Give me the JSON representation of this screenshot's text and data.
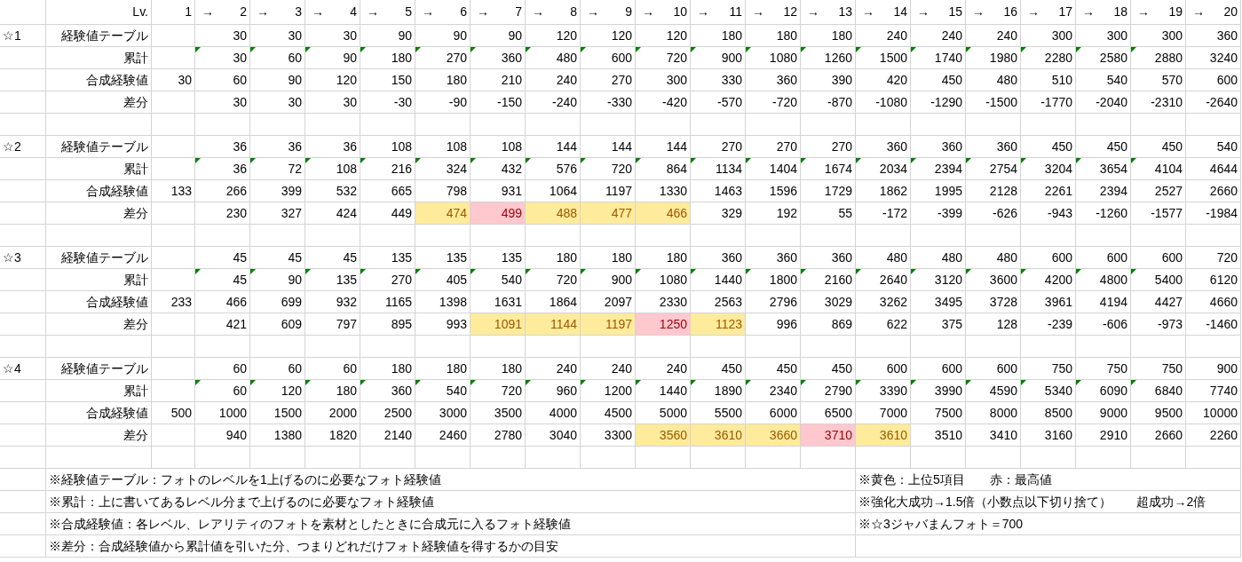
{
  "header": {
    "label": "Lv.",
    "levels": [
      {
        "num": "1"
      },
      {
        "arrow": "→",
        "num": "2"
      },
      {
        "arrow": "→",
        "num": "3"
      },
      {
        "arrow": "→",
        "num": "4"
      },
      {
        "arrow": "→",
        "num": "5"
      },
      {
        "arrow": "→",
        "num": "6"
      },
      {
        "arrow": "→",
        "num": "7"
      },
      {
        "arrow": "→",
        "num": "8"
      },
      {
        "arrow": "→",
        "num": "9"
      },
      {
        "arrow": "→",
        "num": "10"
      },
      {
        "arrow": "→",
        "num": "11"
      },
      {
        "arrow": "→",
        "num": "12"
      },
      {
        "arrow": "→",
        "num": "13"
      },
      {
        "arrow": "→",
        "num": "14"
      },
      {
        "arrow": "→",
        "num": "15"
      },
      {
        "arrow": "→",
        "num": "16"
      },
      {
        "arrow": "→",
        "num": "17"
      },
      {
        "arrow": "→",
        "num": "18"
      },
      {
        "arrow": "→",
        "num": "19"
      },
      {
        "arrow": "→",
        "num": "20"
      }
    ]
  },
  "groups": [
    {
      "rarity": "☆1",
      "rows": [
        {
          "kind": "table",
          "label": "経験値テーブル",
          "cells": [
            "",
            "30",
            "30",
            "30",
            "90",
            "90",
            "90",
            "120",
            "120",
            "120",
            "180",
            "180",
            "180",
            "240",
            "240",
            "240",
            "300",
            "300",
            "300",
            "360"
          ]
        },
        {
          "kind": "cumulative",
          "label": "累計",
          "cells": [
            {
              "flag": false
            },
            {
              "v": "30",
              "flag": true
            },
            {
              "v": "60",
              "flag": true
            },
            {
              "v": "90",
              "flag": true
            },
            {
              "v": "180",
              "flag": true
            },
            {
              "v": "270",
              "flag": true
            },
            {
              "v": "360",
              "flag": true
            },
            {
              "v": "480",
              "flag": true
            },
            {
              "v": "600",
              "flag": true
            },
            {
              "v": "720",
              "flag": true
            },
            {
              "v": "900",
              "flag": true
            },
            {
              "v": "1080",
              "flag": true
            },
            {
              "v": "1260",
              "flag": true
            },
            {
              "v": "1500",
              "flag": true
            },
            {
              "v": "1740",
              "flag": true
            },
            {
              "v": "1980",
              "flag": true
            },
            {
              "v": "2280",
              "flag": true
            },
            {
              "v": "2580",
              "flag": true
            },
            {
              "v": "2880",
              "flag": true
            },
            {
              "v": "3240",
              "flag": false
            }
          ]
        },
        {
          "kind": "synth",
          "label": "合成経験値",
          "cells": [
            "30",
            "60",
            "90",
            "120",
            "150",
            "180",
            "210",
            "240",
            "270",
            "300",
            "330",
            "360",
            "390",
            "420",
            "450",
            "480",
            "510",
            "540",
            "570",
            "600"
          ]
        },
        {
          "kind": "diff",
          "label": "差分",
          "cells": [
            {
              "top5": false,
              "max": false
            },
            {
              "v": "30",
              "top5": false,
              "max": false
            },
            {
              "v": "30",
              "top5": false,
              "max": false
            },
            {
              "v": "30",
              "top5": false,
              "max": false
            },
            {
              "v": "-30",
              "top5": false,
              "max": false
            },
            {
              "v": "-90",
              "top5": false,
              "max": false
            },
            {
              "v": "-150",
              "top5": false,
              "max": false
            },
            {
              "v": "-240",
              "top5": false,
              "max": false
            },
            {
              "v": "-330",
              "top5": false,
              "max": false
            },
            {
              "v": "-420",
              "top5": false,
              "max": false
            },
            {
              "v": "-570",
              "top5": false,
              "max": false
            },
            {
              "v": "-720",
              "top5": false,
              "max": false
            },
            {
              "v": "-870",
              "top5": false,
              "max": false
            },
            {
              "v": "-1080",
              "top5": false,
              "max": false
            },
            {
              "v": "-1290",
              "top5": false,
              "max": false
            },
            {
              "v": "-1500",
              "top5": false,
              "max": false
            },
            {
              "v": "-1770",
              "top5": false,
              "max": false
            },
            {
              "v": "-2040",
              "top5": false,
              "max": false
            },
            {
              "v": "-2310",
              "top5": false,
              "max": false
            },
            {
              "v": "-2640",
              "top5": false,
              "max": false
            }
          ]
        }
      ]
    },
    {
      "rarity": "☆2",
      "rows": [
        {
          "kind": "table",
          "label": "経験値テーブル",
          "cells": [
            "",
            "36",
            "36",
            "36",
            "108",
            "108",
            "108",
            "144",
            "144",
            "144",
            "270",
            "270",
            "270",
            "360",
            "360",
            "360",
            "450",
            "450",
            "450",
            "540"
          ]
        },
        {
          "kind": "cumulative",
          "label": "累計",
          "cells": [
            {
              "flag": false
            },
            {
              "v": "36",
              "flag": true
            },
            {
              "v": "72",
              "flag": true
            },
            {
              "v": "108",
              "flag": true
            },
            {
              "v": "216",
              "flag": true
            },
            {
              "v": "324",
              "flag": true
            },
            {
              "v": "432",
              "flag": true
            },
            {
              "v": "576",
              "flag": true
            },
            {
              "v": "720",
              "flag": true
            },
            {
              "v": "864",
              "flag": true
            },
            {
              "v": "1134",
              "flag": true
            },
            {
              "v": "1404",
              "flag": true
            },
            {
              "v": "1674",
              "flag": true
            },
            {
              "v": "2034",
              "flag": true
            },
            {
              "v": "2394",
              "flag": true
            },
            {
              "v": "2754",
              "flag": true
            },
            {
              "v": "3204",
              "flag": true
            },
            {
              "v": "3654",
              "flag": true
            },
            {
              "v": "4104",
              "flag": true
            },
            {
              "v": "4644",
              "flag": false
            }
          ]
        },
        {
          "kind": "synth",
          "label": "合成経験値",
          "cells": [
            "133",
            "266",
            "399",
            "532",
            "665",
            "798",
            "931",
            "1064",
            "1197",
            "1330",
            "1463",
            "1596",
            "1729",
            "1862",
            "1995",
            "2128",
            "2261",
            "2394",
            "2527",
            "2660"
          ]
        },
        {
          "kind": "diff",
          "label": "差分",
          "cells": [
            {
              "top5": false,
              "max": false
            },
            {
              "v": "230",
              "top5": false,
              "max": false
            },
            {
              "v": "327",
              "top5": false,
              "max": false
            },
            {
              "v": "424",
              "top5": false,
              "max": false
            },
            {
              "v": "449",
              "top5": false,
              "max": false
            },
            {
              "v": "474",
              "top5": true,
              "max": false
            },
            {
              "v": "499",
              "top5": true,
              "max": true
            },
            {
              "v": "488",
              "top5": true,
              "max": false
            },
            {
              "v": "477",
              "top5": true,
              "max": false
            },
            {
              "v": "466",
              "top5": true,
              "max": false
            },
            {
              "v": "329",
              "top5": false,
              "max": false
            },
            {
              "v": "192",
              "top5": false,
              "max": false
            },
            {
              "v": "55",
              "top5": false,
              "max": false
            },
            {
              "v": "-172",
              "top5": false,
              "max": false
            },
            {
              "v": "-399",
              "top5": false,
              "max": false
            },
            {
              "v": "-626",
              "top5": false,
              "max": false
            },
            {
              "v": "-943",
              "top5": false,
              "max": false
            },
            {
              "v": "-1260",
              "top5": false,
              "max": false
            },
            {
              "v": "-1577",
              "top5": false,
              "max": false
            },
            {
              "v": "-1984",
              "top5": false,
              "max": false
            }
          ]
        }
      ]
    },
    {
      "rarity": "☆3",
      "rows": [
        {
          "kind": "table",
          "label": "経験値テーブル",
          "cells": [
            "",
            "45",
            "45",
            "45",
            "135",
            "135",
            "135",
            "180",
            "180",
            "180",
            "360",
            "360",
            "360",
            "480",
            "480",
            "480",
            "600",
            "600",
            "600",
            "720"
          ]
        },
        {
          "kind": "cumulative",
          "label": "累計",
          "cells": [
            {
              "flag": false
            },
            {
              "v": "45",
              "flag": true
            },
            {
              "v": "90",
              "flag": true
            },
            {
              "v": "135",
              "flag": true
            },
            {
              "v": "270",
              "flag": true
            },
            {
              "v": "405",
              "flag": true
            },
            {
              "v": "540",
              "flag": true
            },
            {
              "v": "720",
              "flag": true
            },
            {
              "v": "900",
              "flag": true
            },
            {
              "v": "1080",
              "flag": true
            },
            {
              "v": "1440",
              "flag": true
            },
            {
              "v": "1800",
              "flag": true
            },
            {
              "v": "2160",
              "flag": true
            },
            {
              "v": "2640",
              "flag": true
            },
            {
              "v": "3120",
              "flag": true
            },
            {
              "v": "3600",
              "flag": true
            },
            {
              "v": "4200",
              "flag": true
            },
            {
              "v": "4800",
              "flag": true
            },
            {
              "v": "5400",
              "flag": true
            },
            {
              "v": "6120",
              "flag": false
            }
          ]
        },
        {
          "kind": "synth",
          "label": "合成経験値",
          "cells": [
            "233",
            "466",
            "699",
            "932",
            "1165",
            "1398",
            "1631",
            "1864",
            "2097",
            "2330",
            "2563",
            "2796",
            "3029",
            "3262",
            "3495",
            "3728",
            "3961",
            "4194",
            "4427",
            "4660"
          ]
        },
        {
          "kind": "diff",
          "label": "差分",
          "cells": [
            {
              "top5": false,
              "max": false
            },
            {
              "v": "421",
              "top5": false,
              "max": false
            },
            {
              "v": "609",
              "top5": false,
              "max": false
            },
            {
              "v": "797",
              "top5": false,
              "max": false
            },
            {
              "v": "895",
              "top5": false,
              "max": false
            },
            {
              "v": "993",
              "top5": false,
              "max": false
            },
            {
              "v": "1091",
              "top5": true,
              "max": false
            },
            {
              "v": "1144",
              "top5": true,
              "max": false
            },
            {
              "v": "1197",
              "top5": true,
              "max": false
            },
            {
              "v": "1250",
              "top5": true,
              "max": true
            },
            {
              "v": "1123",
              "top5": true,
              "max": false
            },
            {
              "v": "996",
              "top5": false,
              "max": false
            },
            {
              "v": "869",
              "top5": false,
              "max": false
            },
            {
              "v": "622",
              "top5": false,
              "max": false
            },
            {
              "v": "375",
              "top5": false,
              "max": false
            },
            {
              "v": "128",
              "top5": false,
              "max": false
            },
            {
              "v": "-239",
              "top5": false,
              "max": false
            },
            {
              "v": "-606",
              "top5": false,
              "max": false
            },
            {
              "v": "-973",
              "top5": false,
              "max": false
            },
            {
              "v": "-1460",
              "top5": false,
              "max": false
            }
          ]
        }
      ]
    },
    {
      "rarity": "☆4",
      "rows": [
        {
          "kind": "table",
          "label": "経験値テーブル",
          "cells": [
            "",
            "60",
            "60",
            "60",
            "180",
            "180",
            "180",
            "240",
            "240",
            "240",
            "450",
            "450",
            "450",
            "600",
            "600",
            "600",
            "750",
            "750",
            "750",
            "900"
          ]
        },
        {
          "kind": "cumulative",
          "label": "累計",
          "cells": [
            {
              "flag": false
            },
            {
              "v": "60",
              "flag": true
            },
            {
              "v": "120",
              "flag": true
            },
            {
              "v": "180",
              "flag": true
            },
            {
              "v": "360",
              "flag": true
            },
            {
              "v": "540",
              "flag": true
            },
            {
              "v": "720",
              "flag": true
            },
            {
              "v": "960",
              "flag": true
            },
            {
              "v": "1200",
              "flag": true
            },
            {
              "v": "1440",
              "flag": true
            },
            {
              "v": "1890",
              "flag": true
            },
            {
              "v": "2340",
              "flag": true
            },
            {
              "v": "2790",
              "flag": true
            },
            {
              "v": "3390",
              "flag": true
            },
            {
              "v": "3990",
              "flag": true
            },
            {
              "v": "4590",
              "flag": true
            },
            {
              "v": "5340",
              "flag": true
            },
            {
              "v": "6090",
              "flag": true
            },
            {
              "v": "6840",
              "flag": true
            },
            {
              "v": "7740",
              "flag": false
            }
          ]
        },
        {
          "kind": "synth",
          "label": "合成経験値",
          "cells": [
            "500",
            "1000",
            "1500",
            "2000",
            "2500",
            "3000",
            "3500",
            "4000",
            "4500",
            "5000",
            "5500",
            "6000",
            "6500",
            "7000",
            "7500",
            "8000",
            "8500",
            "9000",
            "9500",
            "10000"
          ]
        },
        {
          "kind": "diff",
          "label": "差分",
          "cells": [
            {
              "top5": false,
              "max": false
            },
            {
              "v": "940",
              "top5": false,
              "max": false
            },
            {
              "v": "1380",
              "top5": false,
              "max": false
            },
            {
              "v": "1820",
              "top5": false,
              "max": false
            },
            {
              "v": "2140",
              "top5": false,
              "max": false
            },
            {
              "v": "2460",
              "top5": false,
              "max": false
            },
            {
              "v": "2780",
              "top5": false,
              "max": false
            },
            {
              "v": "3040",
              "top5": false,
              "max": false
            },
            {
              "v": "3300",
              "top5": false,
              "max": false
            },
            {
              "v": "3560",
              "top5": true,
              "max": false
            },
            {
              "v": "3610",
              "top5": true,
              "max": false
            },
            {
              "v": "3660",
              "top5": true,
              "max": false
            },
            {
              "v": "3710",
              "top5": true,
              "max": true
            },
            {
              "v": "3610",
              "top5": true,
              "max": false
            },
            {
              "v": "3510",
              "top5": false,
              "max": false
            },
            {
              "v": "3410",
              "top5": false,
              "max": false
            },
            {
              "v": "3160",
              "top5": false,
              "max": false
            },
            {
              "v": "2910",
              "top5": false,
              "max": false
            },
            {
              "v": "2660",
              "top5": false,
              "max": false
            },
            {
              "v": "2260",
              "top5": false,
              "max": false
            }
          ]
        }
      ]
    }
  ],
  "notes": [
    {
      "left": "※経験値テーブル：フォトのレベルを1上げるのに必要なフォト経験値",
      "right": [
        "※黄色：上位5項目",
        "赤：最高値"
      ]
    },
    {
      "left": "※累計：上に書いてあるレベル分まで上げるのに必要なフォト経験値",
      "right": [
        "※強化大成功→1.5倍（小数点以下切り捨て）",
        "超成功→2倍"
      ]
    },
    {
      "left": "※合成経験値：各レベル、レアリティのフォトを素材としたときに合成元に入るフォト経験値",
      "right": [
        "※☆3ジャバまんフォト＝700"
      ]
    },
    {
      "left": "※差分：合成経験値から累計値を引いた分、つまりどれだけフォト経験値を得するかの目安"
    }
  ]
}
